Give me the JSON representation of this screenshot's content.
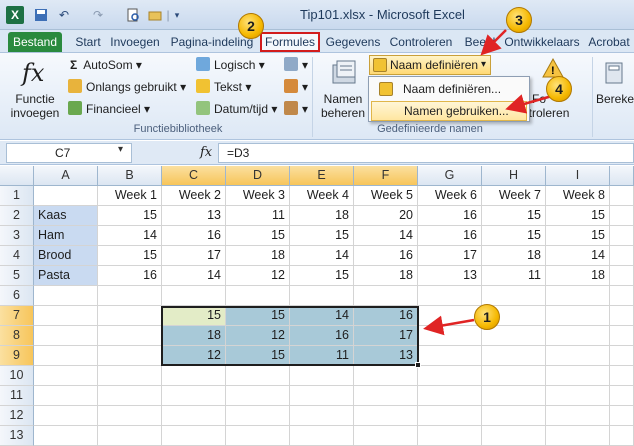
{
  "window": {
    "title": "Tip101.xlsx - Microsoft Excel",
    "app_icon": "X"
  },
  "qat": {
    "undo": "↶",
    "redo": "↷",
    "separator": "|"
  },
  "tabs": [
    "Bestand",
    "Start",
    "Invoegen",
    "Pagina-indeling",
    "Formules",
    "Gegevens",
    "Controleren",
    "Beeld",
    "Ontwikkelaars",
    "Acrobat"
  ],
  "ribbon": {
    "insert_function": {
      "line1": "Functie",
      "line2": "invoegen"
    },
    "autosum": "AutoSom",
    "recent": "Onlangs gebruikt",
    "financial": "Financieel",
    "logical": "Logisch",
    "text": "Tekst",
    "datetime": "Datum/tijd",
    "group_library": "Functiebibliotheek",
    "name_manager": {
      "line1": "Namen",
      "line2": "beheren"
    },
    "define_name": "Naam definiëren",
    "group_defined": "Gedefinieerde namen",
    "errors": {
      "line1": "Fo",
      "line2": "ntroleren"
    },
    "calc": {
      "line1": "Bereke"
    },
    "chevron": "▾"
  },
  "dropdown": {
    "item1": "Naam definiëren...",
    "item2": "Namen gebruiken..."
  },
  "formula_bar": {
    "namebox": "C7",
    "fx": "fx",
    "formula": "=D3"
  },
  "grid": {
    "columns": [
      "A",
      "B",
      "C",
      "D",
      "E",
      "F",
      "G",
      "H",
      "I"
    ],
    "rows": [
      "1",
      "2",
      "3",
      "4",
      "5",
      "6",
      "7",
      "8",
      "9",
      "10",
      "11",
      "12",
      "13"
    ],
    "weeks": [
      "Week 1",
      "Week 2",
      "Week 3",
      "Week 4",
      "Week 5",
      "Week 6",
      "Week 7",
      "Week 8"
    ],
    "items": [
      {
        "name": "Kaas",
        "values": [
          "15",
          "13",
          "11",
          "18",
          "20",
          "16",
          "15",
          "15"
        ]
      },
      {
        "name": "Ham",
        "values": [
          "14",
          "16",
          "15",
          "15",
          "14",
          "16",
          "15",
          "15"
        ]
      },
      {
        "name": "Brood",
        "values": [
          "15",
          "17",
          "18",
          "14",
          "16",
          "17",
          "18",
          "14"
        ]
      },
      {
        "name": "Pasta",
        "values": [
          "16",
          "14",
          "12",
          "15",
          "18",
          "13",
          "11",
          "18"
        ]
      }
    ],
    "selection": [
      [
        "15",
        "15",
        "14",
        "16"
      ],
      [
        "18",
        "12",
        "16",
        "17"
      ],
      [
        "12",
        "15",
        "11",
        "13"
      ]
    ]
  },
  "callouts": [
    "1",
    "2",
    "3",
    "4"
  ],
  "colors": {
    "callout_fill": "#f5b800",
    "arrow_red": "#e02424",
    "highlight_box": "#d21c1c"
  }
}
